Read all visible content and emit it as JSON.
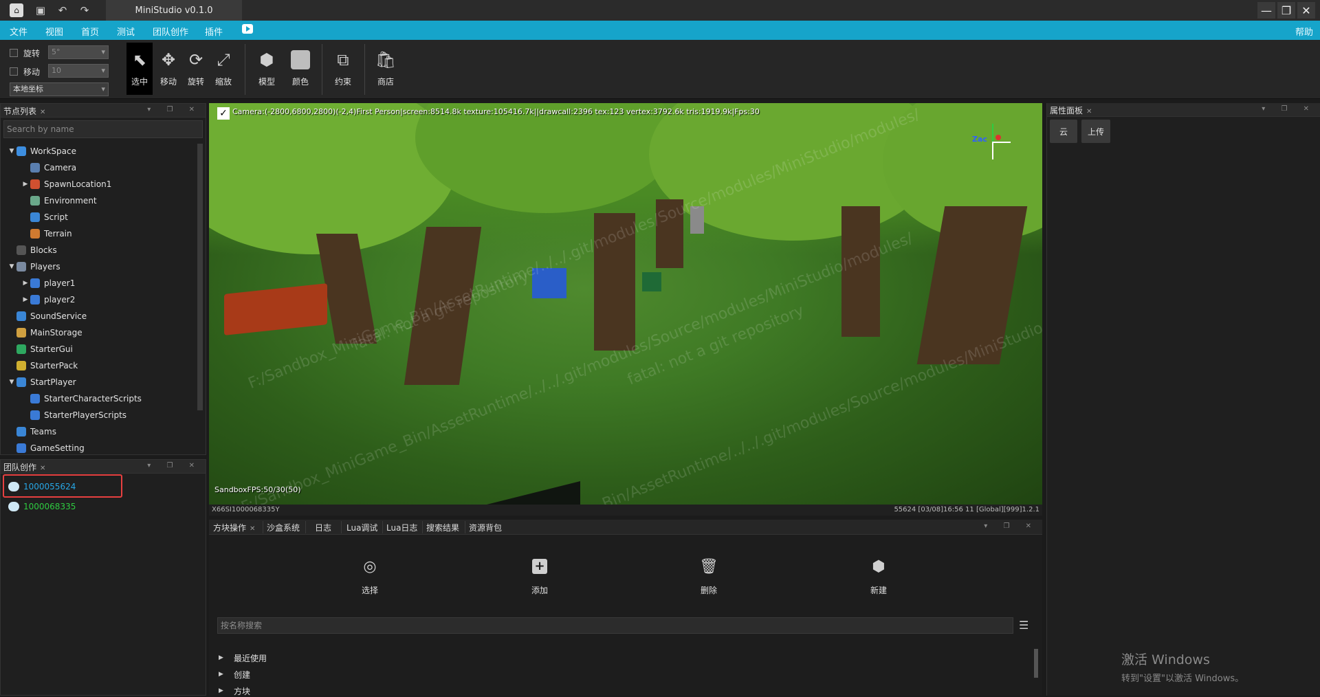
{
  "app": {
    "title": "MiniStudio v0.1.0",
    "accent_color": "#16a4ca"
  },
  "titlebar_icons": [
    "app-logo-icon",
    "save-icon",
    "undo-icon",
    "redo-icon"
  ],
  "menu": {
    "items": [
      "文件",
      "视图",
      "首页",
      "测试",
      "团队创作",
      "插件"
    ],
    "help": "帮助"
  },
  "toolbar": {
    "rotate_label": "旋转",
    "rotate_value": "5°",
    "move_label": "移动",
    "move_value": "10",
    "coord_mode": "本地坐标",
    "tools": [
      {
        "label": "选中",
        "icon": "select-cursor-icon"
      },
      {
        "label": "移动",
        "icon": "move-arrows-icon"
      },
      {
        "label": "旋转",
        "icon": "rotate-icon"
      },
      {
        "label": "缩放",
        "icon": "scale-icon"
      },
      {
        "label": "模型",
        "icon": "model-cube-icon"
      },
      {
        "label": "颜色",
        "icon": "color-square-icon"
      },
      {
        "label": "约束",
        "icon": "constraint-icon"
      },
      {
        "label": "商店",
        "icon": "store-bag-icon"
      }
    ]
  },
  "node_panel": {
    "title": "节点列表",
    "search_placeholder": "Search by name",
    "items": [
      {
        "label": "WorkSpace",
        "expanded": true,
        "color": "#3d8ee0"
      },
      {
        "label": "Camera",
        "color": "#5a7fb0"
      },
      {
        "label": "SpawnLocation1",
        "collapsed": true,
        "color": "#d05030"
      },
      {
        "label": "Environment",
        "color": "#6aa88a"
      },
      {
        "label": "Script",
        "color": "#3a86d6"
      },
      {
        "label": "Terrain",
        "color": "#d07a30"
      },
      {
        "label": "Blocks",
        "color": "#555555"
      },
      {
        "label": "Players",
        "expanded": true,
        "color": "#7a8aa0"
      },
      {
        "label": "player1",
        "collapsed": true,
        "color": "#3a7ad6"
      },
      {
        "label": "player2",
        "collapsed": true,
        "color": "#3a7ad6"
      },
      {
        "label": "SoundService",
        "color": "#3a86d6"
      },
      {
        "label": "MainStorage",
        "color": "#d0a040"
      },
      {
        "label": "StarterGui",
        "color": "#2ea860"
      },
      {
        "label": "StarterPack",
        "color": "#d0b030"
      },
      {
        "label": "StartPlayer",
        "expanded": true,
        "color": "#3a86d6"
      },
      {
        "label": "StarterCharacterScripts",
        "color": "#3a7ad6"
      },
      {
        "label": "StarterPlayerScripts",
        "color": "#3a7ad6"
      },
      {
        "label": "Teams",
        "color": "#3a86d6"
      },
      {
        "label": "GameSetting",
        "color": "#3a7ad6"
      }
    ]
  },
  "team_panel": {
    "title": "团队创作",
    "members": [
      {
        "id": "1000055624",
        "color": "#27a7e6",
        "highlight": true
      },
      {
        "id": "1000068335",
        "color": "#2ecc40"
      }
    ]
  },
  "viewport": {
    "info": "Camera:(-2800,6800,2800)(-2,4)First Person|screen:8514.8k texture:105416.7k||drawcall:2396 tex:123 vertex:3792.6k tris:1919.9k|Fps:30",
    "fps": "SandboxFPS:50/30(50)",
    "footer_left": "X66SI1000068335Y",
    "footer_right": "55624   [03/08]16:56 11  [Global][999]1.2.1",
    "gizmo_label": "Zac",
    "watermark_lines": [
      "F:/Sandbox_MiniGame_Bin/AssetRuntime/../../.git/modules/Source/modules/MiniStudio/modules/",
      "fatal: not a git repository"
    ]
  },
  "bottom_panel": {
    "tabs": [
      "方块操作",
      "沙盒系统",
      "日志",
      "Lua调试",
      "Lua日志",
      "搜索结果",
      "资源背包"
    ],
    "actions": [
      {
        "label": "选择",
        "icon": "select-pointer-icon"
      },
      {
        "label": "添加",
        "icon": "add-square-icon"
      },
      {
        "label": "删除",
        "icon": "trash-icon"
      },
      {
        "label": "新建",
        "icon": "new-block-icon"
      }
    ],
    "search_placeholder": "按名称搜索",
    "categories": [
      "最近使用",
      "创建",
      "方块"
    ]
  },
  "properties_panel": {
    "title": "属性面板",
    "buttons": [
      "云",
      "上传"
    ]
  },
  "os_watermark": {
    "line1": "激活 Windows",
    "line2": "转到\"设置\"以激活 Windows。"
  }
}
